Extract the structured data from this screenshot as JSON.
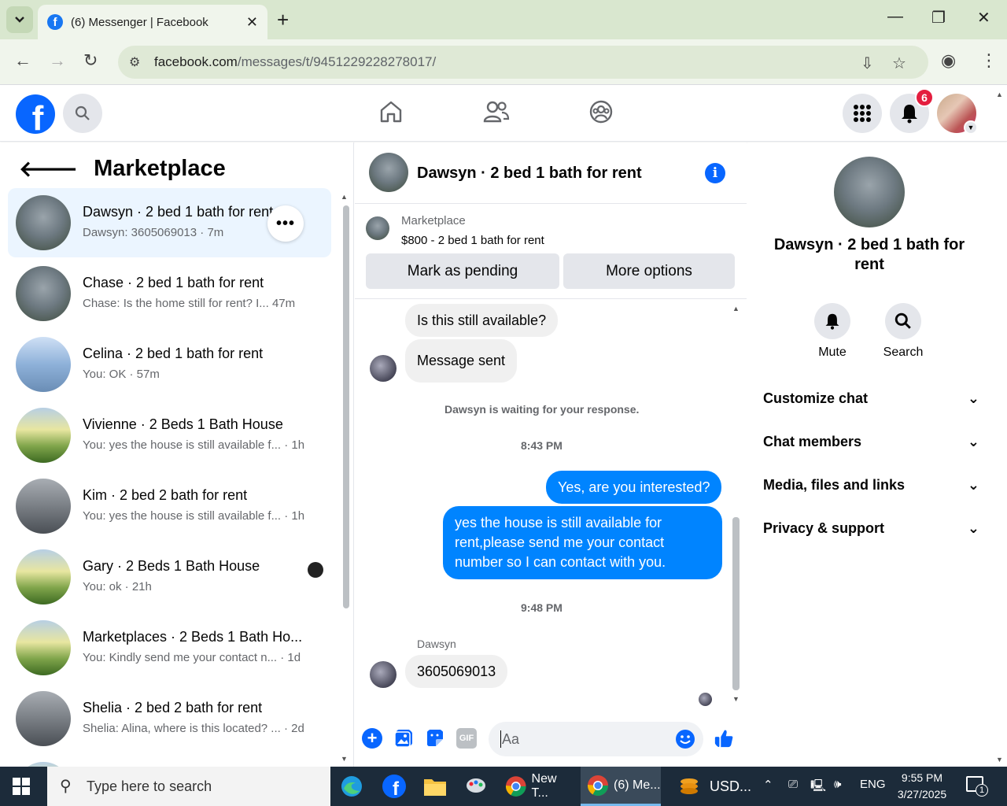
{
  "browser": {
    "tab_title": "(6) Messenger | Facebook",
    "url_host": "facebook.com",
    "url_path": "/messages/t/9451229228278017/"
  },
  "header": {
    "notification_count": "6"
  },
  "left": {
    "title": "Marketplace",
    "conversations": [
      {
        "name": "Dawsyn · 2 bed 1 bath for rent",
        "preview": "Dawsyn: 3605069013 · 7m"
      },
      {
        "name": "Chase · 2 bed 1 bath for rent",
        "preview": "Chase: Is the home still for rent? I...  47m"
      },
      {
        "name": "Celina · 2 bed 1 bath for rent",
        "preview": "You: OK · 57m"
      },
      {
        "name": "Vivienne · 2 Beds 1 Bath House",
        "preview": "You: yes the house is still available f... · 1h"
      },
      {
        "name": "Kim · 2 bed 2 bath for rent",
        "preview": "You: yes the house is still available f... · 1h"
      },
      {
        "name": "Gary · 2 Beds 1 Bath House",
        "preview": "You: ok · 21h"
      },
      {
        "name": "Marketplaces · 2 Beds 1 Bath Ho...",
        "preview": "You: Kindly send me your contact n... · 1d"
      },
      {
        "name": "Shelia · 2 bed 2 bath for rent",
        "preview": "Shelia: Alina, where is this located? ... · 2d"
      }
    ]
  },
  "chat": {
    "title": "Dawsyn · 2 bed 1 bath for rent",
    "listing_label": "Marketplace",
    "listing_price": "$800 - 2 bed 1 bath for rent",
    "mark_pending": "Mark as pending",
    "more_options": "More options",
    "msg1": "Is this still available?",
    "msg2": "Message sent",
    "waiting": "Dawsyn is waiting for your response.",
    "time1": "8:43 PM",
    "out1": "Yes, are you interested?",
    "out2": "yes the house is still available for rent,please send me your contact number so I can contact with you.",
    "time2": "9:48 PM",
    "sender": "Dawsyn",
    "msg3": "3605069013",
    "composer_placeholder": "Aa"
  },
  "right": {
    "name": "Dawsyn · 2 bed 1 bath for rent",
    "mute": "Mute",
    "search": "Search",
    "sections": [
      "Customize chat",
      "Chat members",
      "Media, files and links",
      "Privacy & support"
    ]
  },
  "taskbar": {
    "search_placeholder": "Type here to search",
    "app_newtab": "New T...",
    "app_messenger": "(6) Me...",
    "app_usd": "USD...",
    "lang": "ENG",
    "time": "9:55 PM",
    "date": "3/27/2025",
    "notif": "1"
  }
}
